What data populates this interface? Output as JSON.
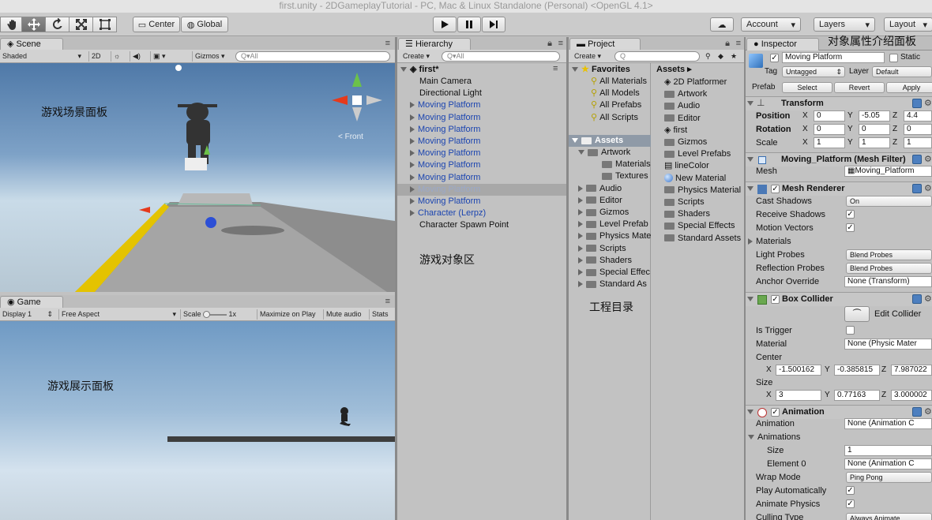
{
  "window_title": "first.unity - 2DGameplayTutorial - PC, Mac & Linux Standalone (Personal) <OpenGL 4.1>",
  "toolbar": {
    "pivot": "Center",
    "space": "Global",
    "account": "Account",
    "layers": "Layers",
    "layout": "Layout"
  },
  "scene": {
    "tab": "Scene",
    "shading": "Shaded",
    "mode2d": "2D",
    "gizmos": "Gizmos",
    "search": "All",
    "persp": "< Front",
    "annotation": "游戏场景面板"
  },
  "game": {
    "tab": "Game",
    "display": "Display 1",
    "aspect": "Free Aspect",
    "scale_label": "Scale",
    "scale_value": "1x",
    "maximize": "Maximize on Play",
    "mute": "Mute audio",
    "stats": "Stats",
    "annotation": "游戏展示面板"
  },
  "hierarchy": {
    "tab": "Hierarchy",
    "create": "Create",
    "search": "All",
    "root": "first*",
    "annotation": "游戏对象区",
    "items": [
      {
        "label": "Main Camera"
      },
      {
        "label": "Directional Light"
      },
      {
        "label": "Moving Platform"
      },
      {
        "label": "Moving Platform"
      },
      {
        "label": "Moving Platform"
      },
      {
        "label": "Moving Platform"
      },
      {
        "label": "Moving Platform"
      },
      {
        "label": "Moving Platform"
      },
      {
        "label": "Moving Platform"
      },
      {
        "label": "Moving Platform"
      },
      {
        "label": "Moving Platform"
      },
      {
        "label": "Character (Lerpz)"
      },
      {
        "label": "Character Spawn Point"
      }
    ]
  },
  "project": {
    "tab": "Project",
    "create": "Create",
    "annotation": "工程目录",
    "favorites_label": "Favorites",
    "favorites": [
      "All Materials",
      "All Models",
      "All Prefabs",
      "All Scripts"
    ],
    "assets_label": "Assets",
    "tree": [
      "Artwork",
      "Materials",
      "Textures",
      "Audio",
      "Editor",
      "Gizmos",
      "Level Prefab",
      "Physics Mate",
      "Scripts",
      "Shaders",
      "Special Effec",
      "Standard As"
    ],
    "assets_header": "Assets",
    "assets": [
      "2D Platformer",
      "Artwork",
      "Audio",
      "Editor",
      "first",
      "Gizmos",
      "Level Prefabs",
      "lineColor",
      "New Material",
      "Physics Material",
      "Scripts",
      "Shaders",
      "Special Effects",
      "Standard Assets"
    ]
  },
  "inspector": {
    "tab": "Inspector",
    "annotation": "对象属性介绍面板",
    "name": "Moving Platform",
    "static": "Static",
    "tag_label": "Tag",
    "tag": "Untagged",
    "layer_label": "Layer",
    "layer": "Default",
    "prefab_label": "Prefab",
    "select": "Select",
    "revert": "Revert",
    "apply": "Apply",
    "transform": {
      "title": "Transform",
      "position": "Position",
      "rotation": "Rotation",
      "scale": "Scale",
      "pos": [
        "0",
        "-5.05",
        "4.4"
      ],
      "rot": [
        "0",
        "0",
        "0"
      ],
      "scl": [
        "1",
        "1",
        "1"
      ]
    },
    "mesh_filter": {
      "title": "Moving_Platform (Mesh Filter)",
      "mesh_label": "Mesh",
      "mesh": "Moving_Platform"
    },
    "mesh_renderer": {
      "title": "Mesh Renderer",
      "cast": "Cast Shadows",
      "cast_value": "On",
      "receive": "Receive Shadows",
      "motion": "Motion Vectors",
      "materials": "Materials",
      "light_probes": "Light Probes",
      "light_value": "Blend Probes",
      "refl": "Reflection Probes",
      "refl_value": "Blend Probes",
      "anchor": "Anchor Override",
      "anchor_value": "None (Transform)"
    },
    "box_collider": {
      "title": "Box Collider",
      "edit": "Edit Collider",
      "trigger": "Is Trigger",
      "material": "Material",
      "material_value": "None (Physic Mater",
      "center": "Center",
      "center_vals": [
        "-1.500162",
        "-0.385815",
        "7.987022"
      ],
      "size": "Size",
      "size_vals": [
        "3",
        "0.77163",
        "3.000002"
      ]
    },
    "animation": {
      "title": "Animation",
      "anim": "Animation",
      "anim_value": "None (Animation C",
      "anims": "Animations",
      "size": "Size",
      "size_value": "1",
      "element": "Element 0",
      "element_value": "None (Animation C",
      "wrap": "Wrap Mode",
      "wrap_value": "Ping Pong",
      "play": "Play Automatically",
      "physics": "Animate Physics",
      "culling": "Culling Type",
      "culling_value": "Always Animate"
    }
  }
}
